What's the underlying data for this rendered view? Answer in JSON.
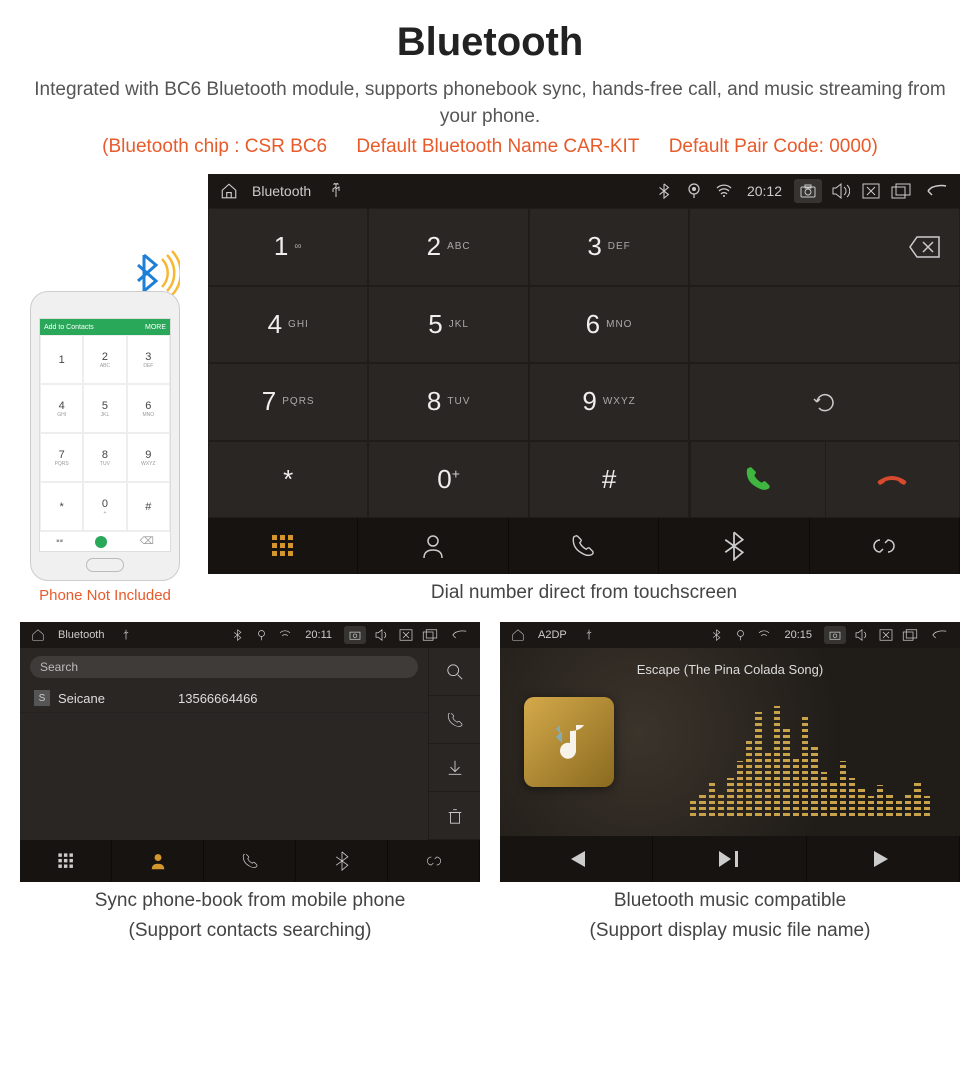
{
  "header": {
    "title": "Bluetooth",
    "subtitle": "Integrated with BC6 Bluetooth module, supports phonebook sync, hands-free call, and music streaming from your phone.",
    "spec_chip": "(Bluetooth chip : CSR BC6",
    "spec_name": "Default Bluetooth Name CAR-KIT",
    "spec_code": "Default Pair Code: 0000)"
  },
  "phone": {
    "topbar_left": "Add to Contacts",
    "topbar_right": "MORE",
    "keys": [
      {
        "n": "1",
        "s": ""
      },
      {
        "n": "2",
        "s": "ABC"
      },
      {
        "n": "3",
        "s": "DEF"
      },
      {
        "n": "4",
        "s": "GHI"
      },
      {
        "n": "5",
        "s": "JKL"
      },
      {
        "n": "6",
        "s": "MNO"
      },
      {
        "n": "7",
        "s": "PQRS"
      },
      {
        "n": "8",
        "s": "TUV"
      },
      {
        "n": "9",
        "s": "WXYZ"
      },
      {
        "n": "*",
        "s": ""
      },
      {
        "n": "0",
        "s": "+"
      },
      {
        "n": "#",
        "s": ""
      }
    ],
    "note": "Phone Not Included"
  },
  "dialer": {
    "status": {
      "title": "Bluetooth",
      "time": "20:12"
    },
    "keys": [
      {
        "n": "1",
        "s": "∞"
      },
      {
        "n": "2",
        "s": "ABC"
      },
      {
        "n": "3",
        "s": "DEF"
      },
      {
        "n": "4",
        "s": "GHI"
      },
      {
        "n": "5",
        "s": "JKL"
      },
      {
        "n": "6",
        "s": "MNO"
      },
      {
        "n": "7",
        "s": "PQRS"
      },
      {
        "n": "8",
        "s": "TUV"
      },
      {
        "n": "9",
        "s": "WXYZ"
      },
      {
        "n": "*",
        "s": ""
      },
      {
        "n": "0",
        "s": "+"
      },
      {
        "n": "#",
        "s": ""
      }
    ],
    "caption": "Dial number direct from touchscreen"
  },
  "contacts": {
    "status": {
      "title": "Bluetooth",
      "time": "20:11"
    },
    "search_placeholder": "Search",
    "row": {
      "badge": "S",
      "name": "Seicane",
      "number": "13566664466"
    },
    "caption1": "Sync phone-book from mobile phone",
    "caption2": "(Support contacts searching)"
  },
  "music": {
    "status": {
      "title": "A2DP",
      "time": "20:15"
    },
    "song": "Escape (The Pina Colada Song)",
    "caption1": "Bluetooth music compatible",
    "caption2": "(Support display music file name)"
  }
}
